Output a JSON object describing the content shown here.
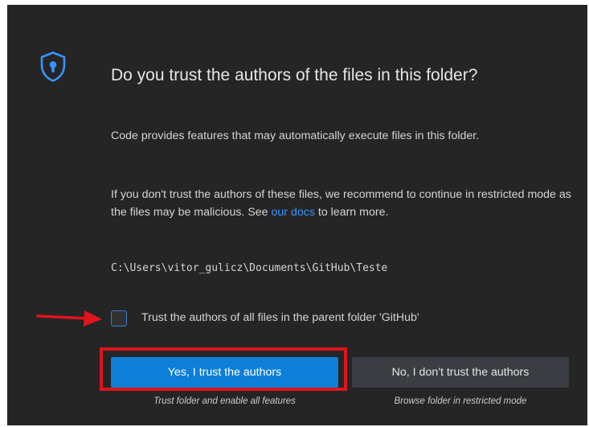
{
  "dialog": {
    "title": "Do you trust the authors of the files in this folder?",
    "icon": "shield-keyhole-icon",
    "paragraph1": "Code provides features that may automatically execute files in this folder.",
    "paragraph2_before": "If you don't trust the authors of these files, we recommend to continue in restricted mode as the files may be malicious. See ",
    "paragraph2_link": "our docs",
    "paragraph2_after": " to learn more.",
    "folder_path": "C:\\Users\\vitor_gulicz\\Documents\\GitHub\\Teste",
    "checkbox": {
      "label": "Trust the authors of all files in the parent folder 'GitHub'",
      "checked": false
    },
    "buttons": {
      "yes_label": "Yes, I trust the authors",
      "yes_caption": "Trust folder and enable all features",
      "no_label": "No, I don't trust the authors",
      "no_caption": "Browse folder in restricted mode"
    }
  },
  "colors": {
    "background": "#252526",
    "primary_button": "#0e7fd8",
    "secondary_button": "#3a3d41",
    "link": "#3794ff",
    "annotation_red": "#e0141b"
  }
}
